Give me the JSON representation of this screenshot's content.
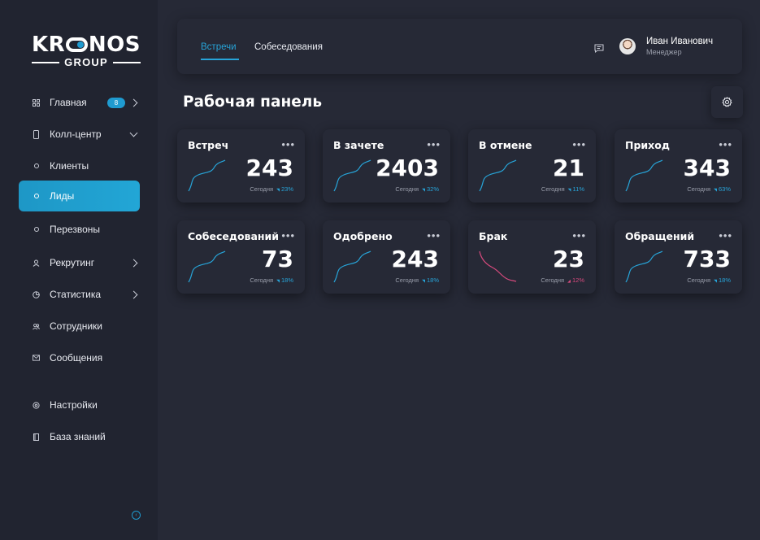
{
  "brand": {
    "name_top": "KR NOS",
    "name_bottom": "GROUP"
  },
  "sidebar": {
    "items": [
      {
        "label": "Главная",
        "icon": "home-icon",
        "badge": "8",
        "arrow": "right"
      },
      {
        "label": "Колл-центр",
        "icon": "phone-icon",
        "arrow": "down"
      },
      {
        "label": "Клиенты",
        "icon": "ring-icon"
      },
      {
        "label": "Лиды",
        "icon": "ring-icon",
        "active": true
      },
      {
        "label": "Перезвоны",
        "icon": "ring-icon"
      },
      {
        "label": "Рекрутинг",
        "icon": "user-icon",
        "arrow": "right"
      },
      {
        "label": "Статистика",
        "icon": "pie-chart-icon",
        "arrow": "right"
      },
      {
        "label": "Сотрудники",
        "icon": "users-icon"
      },
      {
        "label": "Сообщения",
        "icon": "mail-icon"
      },
      {
        "label": "Настройки",
        "icon": "settings-icon"
      },
      {
        "label": "База знаний",
        "icon": "book-icon"
      }
    ],
    "collapse_icon": "collapse-left-icon"
  },
  "header": {
    "tabs": [
      {
        "label": "Встречи",
        "active": true
      },
      {
        "label": "Собеседования",
        "active": false
      }
    ],
    "user": {
      "name": "Иван Иванович",
      "role": "Менеджер"
    }
  },
  "page": {
    "title": "Рабочая панель"
  },
  "colors": {
    "accent": "#27a4d8",
    "negative": "#d84a7e",
    "background": "#262936",
    "sidebar": "#212430"
  },
  "cards": [
    {
      "title": "Встреч",
      "value": "243",
      "period": "Сегодня",
      "change": "23%",
      "trend": "up"
    },
    {
      "title": "В зачете",
      "value": "2403",
      "period": "Сегодня",
      "change": "32%",
      "trend": "up"
    },
    {
      "title": "В отмене",
      "value": "21",
      "period": "Сегодня",
      "change": "11%",
      "trend": "up"
    },
    {
      "title": "Приход",
      "value": "343",
      "period": "Сегодня",
      "change": "63%",
      "trend": "up"
    },
    {
      "title": "Собеседований",
      "value": "73",
      "period": "Сегодня",
      "change": "18%",
      "trend": "up"
    },
    {
      "title": "Одобрено",
      "value": "243",
      "period": "Сегодня",
      "change": "18%",
      "trend": "up"
    },
    {
      "title": "Брак",
      "value": "23",
      "period": "Сегодня",
      "change": "12%",
      "trend": "down"
    },
    {
      "title": "Обращений",
      "value": "733",
      "period": "Сегодня",
      "change": "18%",
      "trend": "up"
    }
  ]
}
